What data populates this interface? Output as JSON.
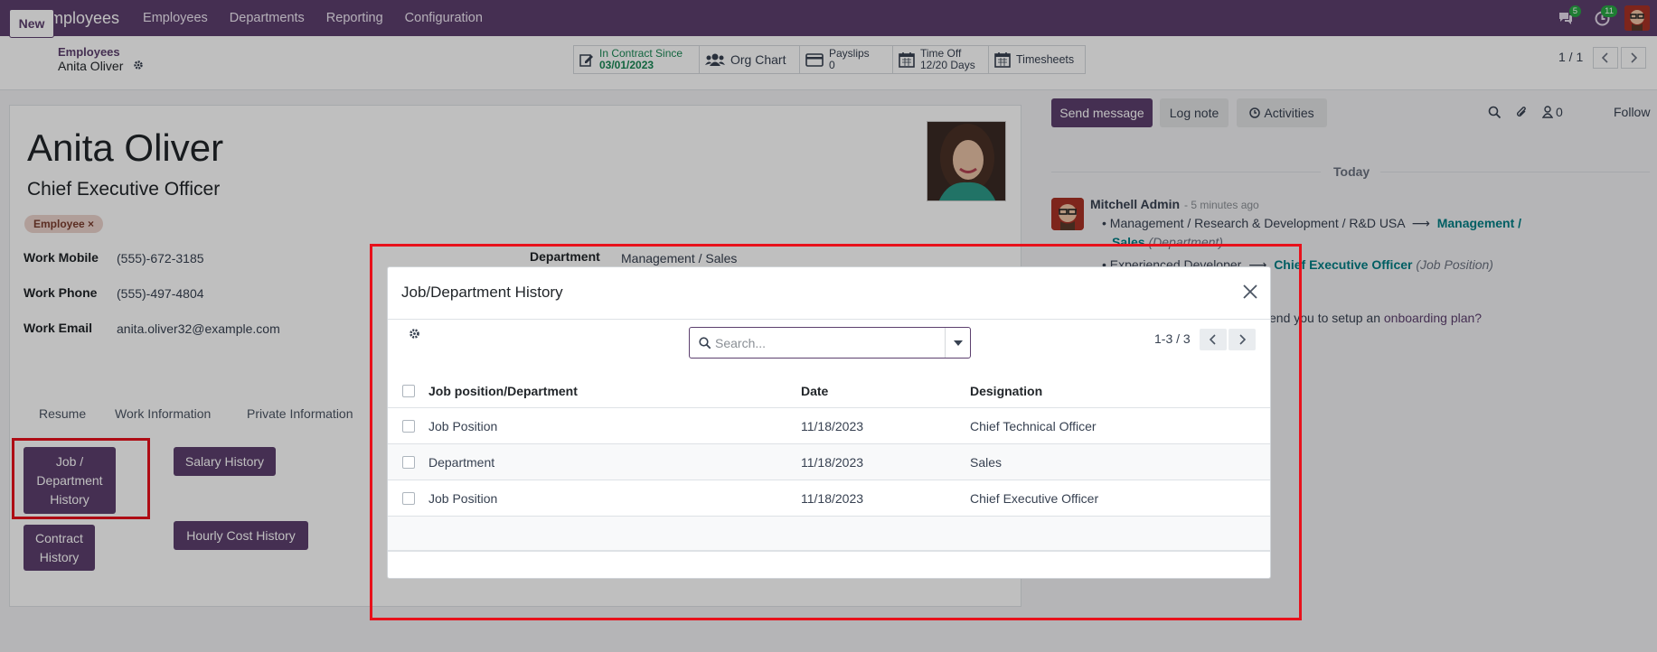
{
  "navbar": {
    "app_name": "Employees",
    "menus": [
      "Employees",
      "Departments",
      "Reporting",
      "Configuration"
    ],
    "messages_count": "5",
    "activities_count": "11"
  },
  "control": {
    "new_label": "New",
    "breadcrumb_parent": "Employees",
    "breadcrumb_current": "Anita Oliver",
    "smart_buttons": {
      "contract_label": "In Contract Since",
      "contract_value": "03/01/2023",
      "org_chart": "Org Chart",
      "payslips_label": "Payslips",
      "payslips_value": "0",
      "time_off_label": "Time Off",
      "time_off_value": "12/20 Days",
      "timesheets": "Timesheets"
    },
    "pager": "1 / 1"
  },
  "employee": {
    "name": "Anita Oliver",
    "job_title": "Chief Executive Officer",
    "tag": "Employee",
    "fields": {
      "work_mobile_label": "Work Mobile",
      "work_mobile": "(555)-672-3185",
      "work_phone_label": "Work Phone",
      "work_phone": "(555)-497-4804",
      "work_email_label": "Work Email",
      "work_email": "anita.oliver32@example.com",
      "department_label": "Department",
      "department": "Management / Sales"
    },
    "tabs": [
      "Resume",
      "Work Information",
      "Private Information"
    ],
    "history_buttons": {
      "job_dept_line1": "Job /",
      "job_dept_line2": "Department",
      "job_dept_line3": "History",
      "salary": "Salary History",
      "contract_line1": "Contract",
      "contract_line2": "History",
      "hourly_cost": "Hourly Cost History"
    }
  },
  "chatter": {
    "send_message": "Send message",
    "log_note": "Log note",
    "activities": "Activities",
    "followers_count": "0",
    "follow": "Follow",
    "today": "Today",
    "author": "Mitchell Admin",
    "when": "- 5 minutes ago",
    "change1_old": "Management / Research & Development / R&D USA",
    "change1_new_a": "Management /",
    "change1_new_b": "Sales",
    "change1_field": "(Department)",
    "change2_old": "Experienced Developer",
    "change2_new": "Chief Executive Officer",
    "change2_field": "(Job Position)",
    "onboarding_prefix": "end you to setup an",
    "onboarding_link": "onboarding plan?"
  },
  "dialog": {
    "title": "Job/Department History",
    "search_placeholder": "Search...",
    "pager": "1-3 / 3",
    "columns": [
      "Job position/Department",
      "Date",
      "Designation"
    ],
    "rows": [
      {
        "type": "Job Position",
        "date": "11/18/2023",
        "designation": "Chief Technical Officer"
      },
      {
        "type": "Department",
        "date": "11/18/2023",
        "designation": "Sales"
      },
      {
        "type": "Job Position",
        "date": "11/18/2023",
        "designation": "Chief Executive Officer"
      }
    ]
  },
  "colors": {
    "brand": "#5c3f6e",
    "highlight": "#e8111b",
    "link": "#017e84",
    "success": "#198754"
  }
}
